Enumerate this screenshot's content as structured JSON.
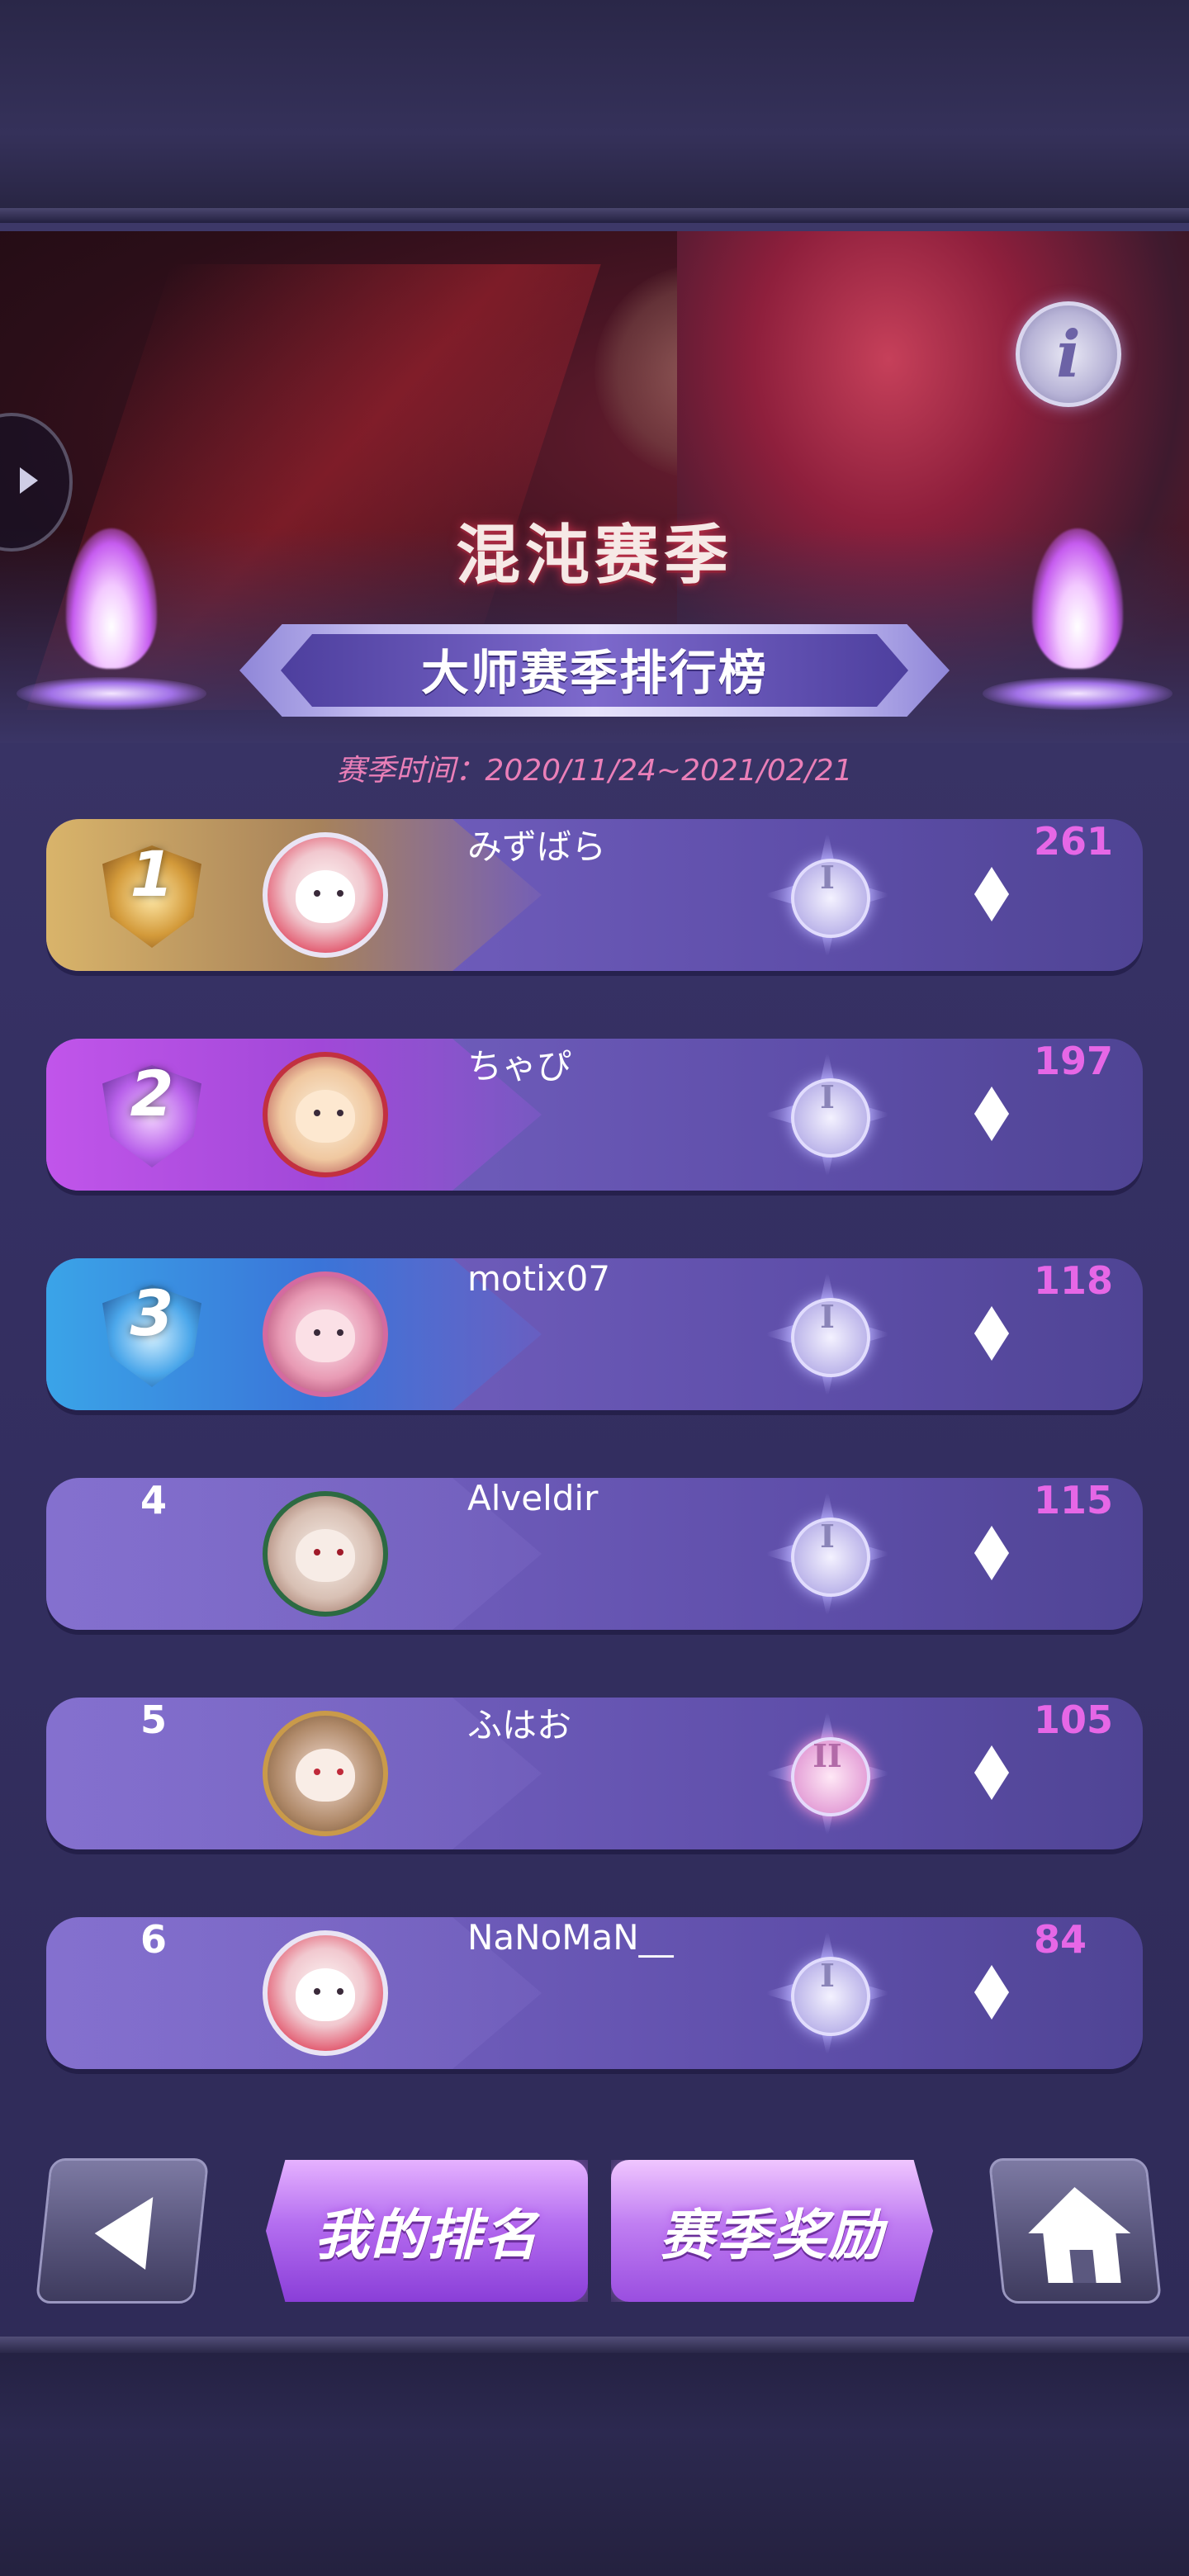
{
  "banner": {
    "season_name": "混沌赛季",
    "leaderboard_title": "大师赛季排行榜",
    "season_time": "赛季时间：2020/11/24~2021/02/21",
    "info_icon": "info-icon"
  },
  "rows": [
    {
      "rank": "1",
      "name": "みずばら",
      "tier": "I",
      "score": "261"
    },
    {
      "rank": "2",
      "name": "ちゃぴ",
      "tier": "I",
      "score": "197"
    },
    {
      "rank": "3",
      "name": "motix07",
      "tier": "I",
      "score": "118"
    },
    {
      "rank": "4",
      "name": "Alveldir",
      "tier": "I",
      "score": "115"
    },
    {
      "rank": "5",
      "name": "ふはお",
      "tier": "II",
      "score": "105"
    },
    {
      "rank": "6",
      "name": "NaNoMaN__",
      "tier": "I",
      "score": "84"
    }
  ],
  "bottom": {
    "my_rank_label": "我的排名",
    "season_reward_label": "赛季奖励",
    "back_icon": "back-arrow-icon",
    "home_icon": "home-icon"
  },
  "colors": {
    "score": "#e667e6",
    "season_time": "#ea7fb8",
    "row_bg": "#6c5ab8",
    "gold_accent": "#d9b46a",
    "purple_accent": "#c155ea",
    "blue_accent": "#3aa4e8"
  }
}
